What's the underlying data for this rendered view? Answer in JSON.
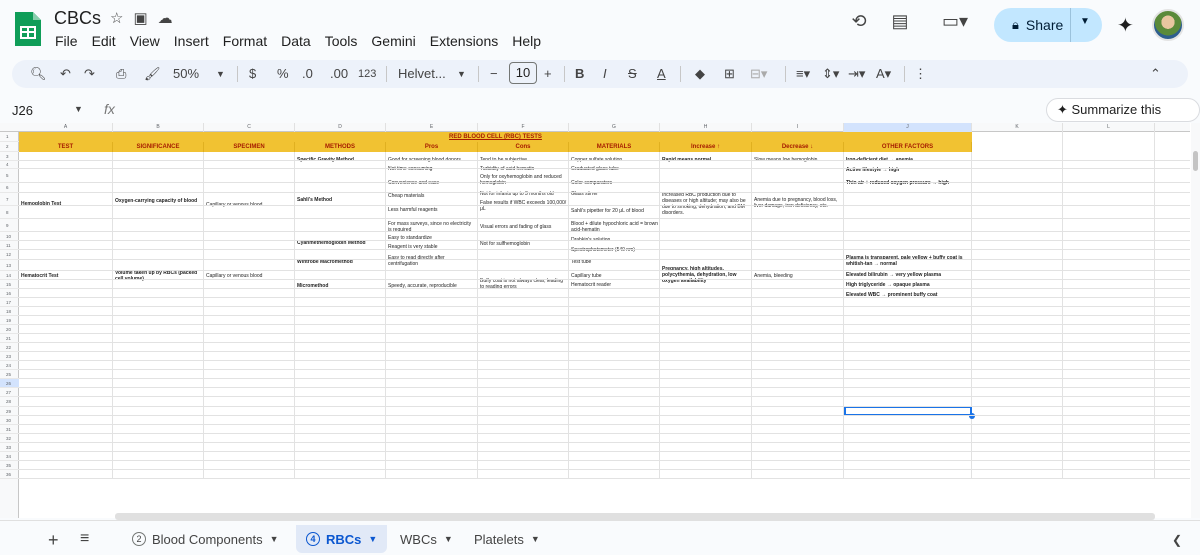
{
  "doc": {
    "title": "CBCs"
  },
  "menu": [
    "File",
    "Edit",
    "View",
    "Insert",
    "Format",
    "Data",
    "Tools",
    "Gemini",
    "Extensions",
    "Help"
  ],
  "share_label": "Share",
  "toolbar": {
    "zoom": "50%",
    "currency": "$",
    "percent": "%",
    "dec_dec": ".0",
    "dec_inc": ".00",
    "format_num": "123",
    "font": "Helvet...",
    "font_size": "10",
    "bold": "B",
    "italic": "I",
    "text_color": "A"
  },
  "formula": {
    "cell_ref": "J26",
    "fx": "fx",
    "summarize": "Summarize this data"
  },
  "grid": {
    "columns": [
      "A",
      "B",
      "C",
      "D",
      "E",
      "F",
      "G",
      "H",
      "I",
      "J",
      "K",
      "L"
    ],
    "rows": [
      "1",
      "2",
      "3",
      "4",
      "5",
      "6",
      "7",
      "8",
      "9",
      "10",
      "11",
      "12",
      "13",
      "14",
      "15",
      "16",
      "17",
      "18",
      "19",
      "20",
      "21",
      "22",
      "23",
      "24",
      "25",
      "26",
      "27",
      "28",
      "29",
      "30",
      "31",
      "32",
      "33",
      "34",
      "35",
      "36"
    ],
    "title": "RED BLOOD CELL (RBC) TESTS",
    "headers": [
      "TEST",
      "SIGNIFICANCE",
      "SPECIMEN",
      "METHODS",
      "Pros",
      "Cons",
      "MATERIALS",
      "Increase ↑",
      "Decrease ↓",
      "OTHER FACTORS"
    ],
    "hb": {
      "test": "Hemoglobin Test",
      "significance": "Oxygen-carrying capacity of blood",
      "specimen": "Capillary or venous blood",
      "m1": "Specific Gravity Method",
      "m2": "Sahli's Method",
      "m3": "Cyanmethemoglobin Method",
      "p1": "Good for screening blood donors",
      "p2": "Not time-consuming",
      "p3": "Convenience and ease",
      "p4": "Cheap materials",
      "p5": "Less harmful reagents",
      "p6": "For mass surveys, since no electricity is required",
      "p7": "Easy to standardize",
      "p8": "Reagent is very stable",
      "c1": "Tend to be subjective",
      "c2": "Turbidity of acid hematin",
      "c3": "Only for oxyhemoglobin and reduced hemoglobin",
      "c4": "Not for infants up to 3 months old",
      "c5": "False results if WBC exceeds 100,000/μL",
      "c6": "Visual errors and fading of glass",
      "c7": "Not for sulfhemoglobin",
      "mat1": "Copper sulfate solution",
      "mat2": "Graduated glass tube",
      "mat3": "Color comparators",
      "mat4": "Glass stirrer",
      "mat5": "Sahli's pipetter for 20 μL of blood",
      "mat6": "Blood + dilute hypochloric acid = brown acid-hematin",
      "mat7": "Drabkin's solution",
      "mat8": "Spectrophotometer (540 nm)",
      "inc1": "Rapid means normal",
      "inc2": "Increased RBC production due to diseases or high altitude; may also be due to smoking, dehydration, and BM disorders.",
      "dec1": "Slow means low hemoglobin",
      "dec2": "Anemia due to pregnancy, blood loss, liver damage, iron deficiency, etc.",
      "o1": "Iron-deficient diet → anemia",
      "o2": "Active lifestyle → high",
      "o3": "Thin air + reduced oxygen pressure → high"
    },
    "hct": {
      "test": "Hematocrit Test",
      "significance": "Volume taken up by RBCs (packed cell volume)",
      "specimen": "Capillary or venous blood",
      "m1": "Wintrobe Macromethod",
      "m2": "Micromethod",
      "p1": "Easy to read directly after centrifugation",
      "p2": "Speedy, accurate, reproducible",
      "c1": "Buffy coat is not always clear, leading to reading errors",
      "mat1": "Test tube",
      "mat2": "Capillary tube",
      "mat3": "Hematocrit reader",
      "inc": "Pregnancy, high altitudes, polycythemia, dehydration, low oxygen availability",
      "dec": "Anemia, bleeding",
      "o1": "Plasma is transparent, pale yellow + buffy coat is whitish-tan → normal",
      "o2": "Elevated bilirubin → very yellow plasma",
      "o3": "High triglyceride → opaque plasma",
      "o4": "Elevated WBC → prominent buffy coat"
    }
  },
  "sheets": [
    {
      "num": "2",
      "name": "Blood Components"
    },
    {
      "num": "4",
      "name": "RBCs"
    },
    {
      "name": "WBCs"
    },
    {
      "name": "Platelets"
    }
  ],
  "colors": {
    "header_yellow": "#f1c232",
    "header_text": "#a61c00",
    "accent": "#1a73e8",
    "share_bg": "#c2e7ff"
  }
}
